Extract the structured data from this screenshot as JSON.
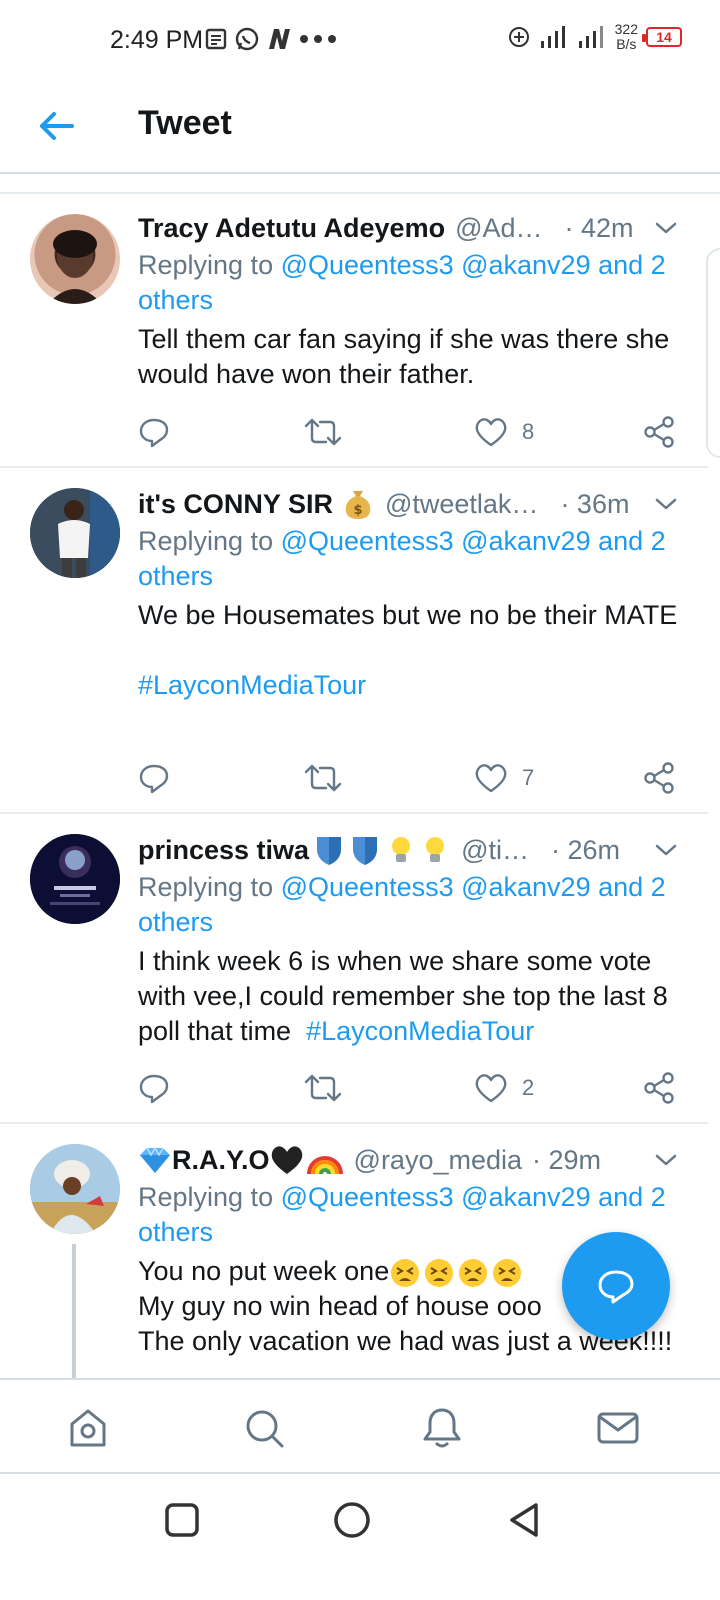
{
  "status_bar": {
    "time": "2:49 PM",
    "net_speed_value": "322",
    "net_speed_unit": "B/s",
    "battery": "14",
    "icons": [
      "notes-icon",
      "whatsapp-icon",
      "n-app-icon",
      "more-dots-icon",
      "data-saver-icon",
      "signal-icon",
      "signal-icon"
    ]
  },
  "header": {
    "title": "Tweet",
    "back_icon": "back-arrow-icon"
  },
  "colors": {
    "accent": "#1d9bf0",
    "secondary_text": "#657786",
    "battery_low": "#e0262b"
  },
  "tweets": [
    {
      "name": "Tracy Adetutu Adeyemo",
      "handle": "@Ad…",
      "time": "· 42m",
      "reply_prefix": "Replying to ",
      "reply_mentions": "@Queentess3 @akanv29 and 2 others",
      "text": "Tell them car fan saying if she was there she would have won their father.",
      "hashtag": "",
      "like_count": "8"
    },
    {
      "name": "it's CONNY SIR",
      "name_emoji": "money-bag-emoji",
      "handle": "@tweetlak…",
      "time": "· 36m",
      "reply_prefix": "Replying to ",
      "reply_mentions": "@Queentess3 @akanv29 and 2 others",
      "text": "We be Housemates but we no be their MATE\n\n",
      "hashtag": "#LayconMediaTour",
      "like_count": "7"
    },
    {
      "name": "princess tiwa",
      "name_emoji": "shield-shield-bulb-bulb-emoji",
      "handle": "@ti…",
      "time": "· 26m",
      "reply_prefix": "Replying to ",
      "reply_mentions": "@Queentess3 @akanv29 and 2 others",
      "text": "I think week 6 is when we share some vote with vee,I could remember she top the last 8 poll that time  ",
      "hashtag": "#LayconMediaTour",
      "like_count": "2"
    },
    {
      "name": "R.A.Y.O",
      "name_emoji": "diamond-heart-rainbow-emoji",
      "handle": "@rayo_media",
      "time": "· 29m",
      "reply_prefix": "Replying to ",
      "reply_mentions": "@Queentess3 @akanv29 and 2 others",
      "text_line1": "You no put week one",
      "text_rest": "My guy no win head of house ooo\nThe only vacation we had was just a week!!!!",
      "hashtag": ""
    }
  ],
  "action_icons": [
    "reply-icon",
    "retweet-icon",
    "like-icon",
    "share-icon"
  ],
  "fab": {
    "icon": "compose-reply-icon"
  },
  "bottom_nav": [
    "home-icon",
    "search-icon",
    "notifications-icon",
    "messages-icon"
  ],
  "system_nav": [
    "recents-icon",
    "home-circle-icon",
    "back-triangle-icon"
  ]
}
